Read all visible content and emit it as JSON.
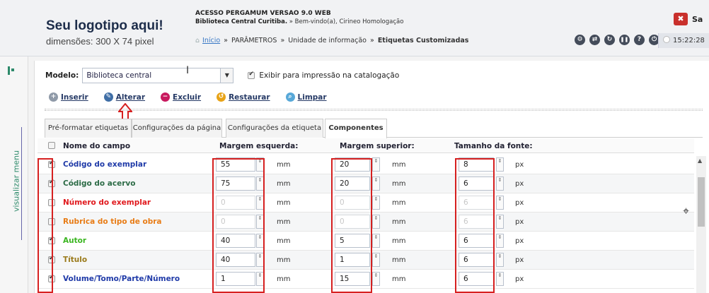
{
  "header": {
    "logo_title": "Seu logotipo aqui!",
    "logo_sub": "dimensões: 300 X 74 pixel",
    "system_title": "ACESSO PERGAMUM VERSAO 9.0 WEB",
    "library_name": "Biblioteca Central Curitiba.",
    "welcome": " » Bem-vindo(a), Cirineo Homologação",
    "exit_label": "Sa",
    "exit_icon": "✖",
    "clock": "15:22:28"
  },
  "breadcrumb": {
    "home_icon": "⌂",
    "home": "Início",
    "sep": "»",
    "level1": "PARÂMETROS",
    "level2": "Unidade de informação",
    "current": "Etiquetas Customizadas"
  },
  "header_icons": [
    {
      "name": "settings-icon",
      "glyph": "⚙"
    },
    {
      "name": "swap-icon",
      "glyph": "⇄"
    },
    {
      "name": "refresh-icon",
      "glyph": "↻"
    },
    {
      "name": "pause-icon",
      "glyph": "❚❚"
    },
    {
      "name": "help-icon",
      "glyph": "?"
    },
    {
      "name": "power-icon",
      "glyph": "⏻"
    }
  ],
  "sidebar": {
    "menu_label": "visualizar  menu"
  },
  "model": {
    "label": "Modelo:",
    "value": "Biblioteca central",
    "caret": "▼",
    "print_option": "Exibir para impressão na catalogação"
  },
  "toolbar": {
    "insert": "Inserir",
    "edit": "Alterar",
    "delete": "Excluir",
    "restore": "Restaurar",
    "clear": "Limpar"
  },
  "tabs": [
    "Pré-formatar etiquetas",
    "Configurações da página",
    "Configurações da etiqueta",
    "Componentes"
  ],
  "table": {
    "headers": {
      "name": "Nome do campo",
      "left_margin": "Margem esquerda:",
      "top_margin": "Margem superior:",
      "font_size": "Tamanho da fonte:"
    },
    "units": {
      "margin": "mm",
      "font": "px"
    },
    "spinner": "⇕",
    "rows": [
      {
        "checked": true,
        "name": "Código do exemplar",
        "color": "#1f3aa8",
        "left": "55",
        "top": "20",
        "font": "8",
        "disabled": false
      },
      {
        "checked": true,
        "name": "Código do acervo",
        "color": "#2c6b46",
        "left": "75",
        "top": "20",
        "font": "6",
        "disabled": false
      },
      {
        "checked": false,
        "name": "Número do exemplar",
        "color": "#e0191d",
        "left": "0",
        "top": "0",
        "font": "6",
        "disabled": true
      },
      {
        "checked": false,
        "name": "Rubrica do tipo de obra",
        "color": "#e87c16",
        "left": "0",
        "top": "0",
        "font": "6",
        "disabled": true
      },
      {
        "checked": true,
        "name": "Autor",
        "color": "#39b51f",
        "left": "40",
        "top": "5",
        "font": "6",
        "disabled": false
      },
      {
        "checked": true,
        "name": "Título",
        "color": "#9a7a1a",
        "left": "40",
        "top": "1",
        "font": "6",
        "disabled": false
      },
      {
        "checked": true,
        "name": "Volume/Tomo/Parte/Número",
        "color": "#1f3aa8",
        "left": "1",
        "top": "15",
        "font": "6",
        "disabled": false
      }
    ]
  },
  "colors": {
    "accent": "#2d8a6a",
    "highlight": "#d62020",
    "link": "#3777c5"
  }
}
